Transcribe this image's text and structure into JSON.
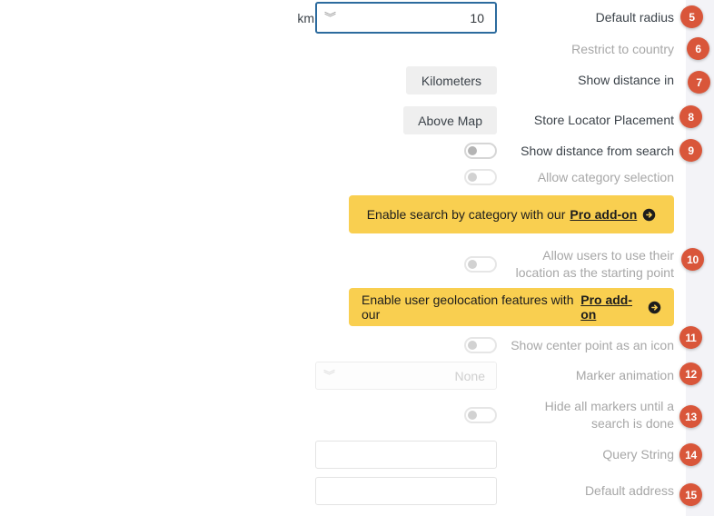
{
  "theme": {
    "badge_color": "#d9563a",
    "promo_bg": "#f9cf50",
    "focus_border": "#2c6b9e",
    "panel_bg": "#f3f3f7"
  },
  "rows": {
    "default_radius": {
      "label": "Default radius",
      "badge": "5",
      "unit_suffix": "km",
      "value": "10",
      "chevron": "chevron-down"
    },
    "restrict_country": {
      "label": "Restrict to country",
      "badge": "6"
    },
    "show_distance_in": {
      "label": "Show distance in",
      "badge": "7",
      "button": "Kilometers"
    },
    "store_locator_placement": {
      "label": "Store Locator Placement",
      "badge": "8",
      "button": "Above Map"
    },
    "show_distance_from_search": {
      "label": "Show distance from search",
      "badge": "9",
      "toggle": "off"
    },
    "allow_category_selection": {
      "label": "Allow category selection",
      "badge": "",
      "toggle": "off"
    },
    "allow_user_location": {
      "label": "Allow users to use their location as the starting point",
      "label_line1": "Allow users to use their",
      "label_line2": "location as the starting point",
      "badge": "10",
      "toggle": "off"
    },
    "show_center_point": {
      "label": "Show center point as an icon",
      "badge": "11",
      "toggle": "off"
    },
    "marker_animation": {
      "label": "Marker animation",
      "badge": "12",
      "value": "None"
    },
    "hide_all_markers": {
      "label": "Hide all markers until a search is done",
      "label_line1": "Hide all markers until a",
      "label_line2": "search is done",
      "badge": "13",
      "toggle": "off"
    },
    "query_string": {
      "label": "Query String",
      "badge": "14",
      "value": "",
      "placeholder": ""
    },
    "default_address": {
      "label": "Default address",
      "badge": "15",
      "value": "",
      "placeholder": ""
    }
  },
  "promos": {
    "category": {
      "text": "Enable search by category with our",
      "link": "Pro add-on",
      "icon": "arrow-circle-right-icon"
    },
    "geolocation": {
      "text": "Enable user geolocation features with our",
      "link": "Pro add-on",
      "icon": "arrow-circle-right-icon"
    }
  }
}
